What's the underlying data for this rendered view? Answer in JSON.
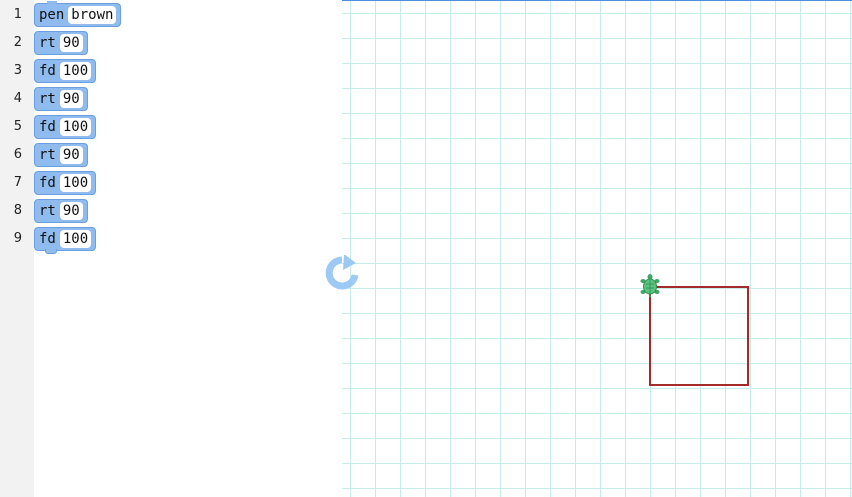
{
  "editor": {
    "lines": [
      {
        "number": "1",
        "cmd": "pen",
        "arg": "brown"
      },
      {
        "number": "2",
        "cmd": "rt",
        "arg": "90"
      },
      {
        "number": "3",
        "cmd": "fd",
        "arg": "100"
      },
      {
        "number": "4",
        "cmd": "rt",
        "arg": "90"
      },
      {
        "number": "5",
        "cmd": "fd",
        "arg": "100"
      },
      {
        "number": "6",
        "cmd": "rt",
        "arg": "90"
      },
      {
        "number": "7",
        "cmd": "fd",
        "arg": "100"
      },
      {
        "number": "8",
        "cmd": "rt",
        "arg": "90"
      },
      {
        "number": "9",
        "cmd": "fd",
        "arg": "100"
      }
    ]
  },
  "canvas": {
    "pen_color": "#a52a2a",
    "turtle_color": "#3fa766",
    "grid_color": "#c6ebe8",
    "run_icon": "reload-icon"
  }
}
